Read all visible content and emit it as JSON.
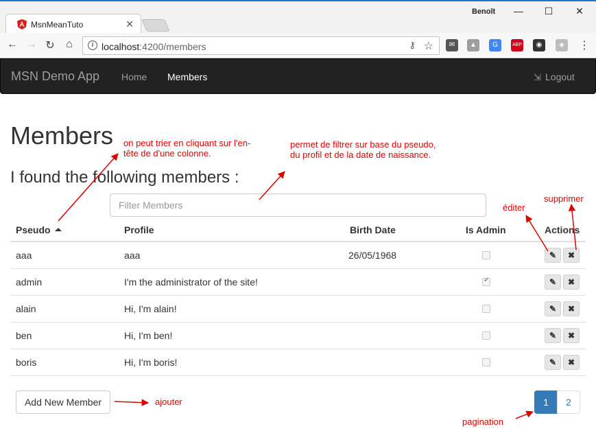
{
  "browser": {
    "tab_title": "MsnMeanTuto",
    "tab_close": "✕",
    "profile_name": "Benoît",
    "url_host": "localhost",
    "url_path": ":4200/members",
    "icons": [
      "back-icon",
      "forward-icon",
      "reload-icon",
      "home-icon",
      "info-icon",
      "key-icon",
      "star-icon"
    ],
    "window_buttons": {
      "minimize": "—",
      "maximize": "☐",
      "close": "✕"
    },
    "extensions": [
      {
        "name": "mail-extension-icon",
        "glyph": "✉",
        "color": "#555555"
      },
      {
        "name": "drive-extension-icon",
        "glyph": "▲",
        "color": "#9e9e9e"
      },
      {
        "name": "translate-extension-icon",
        "glyph": "G",
        "color": "#4285f4"
      },
      {
        "name": "adblock-extension-icon",
        "glyph": "ABP",
        "color": "#d0021b"
      },
      {
        "name": "lastpass-extension-icon",
        "glyph": "◉",
        "color": "#333333"
      },
      {
        "name": "cube-extension-icon",
        "glyph": "◈",
        "color": "#bdbdbd"
      }
    ],
    "menu_glyph": "⋮"
  },
  "navbar": {
    "brand": "MSN Demo App",
    "links": [
      {
        "label": "Home",
        "active": false
      },
      {
        "label": "Members",
        "active": true
      }
    ],
    "logout_icon": "⇲",
    "logout_label": "Logout"
  },
  "main": {
    "title": "Members",
    "subtitle": "I found the following members :",
    "filter_placeholder": "Filter Members",
    "columns": [
      "Pseudo",
      "Profile",
      "Birth Date",
      "Is Admin",
      "Actions"
    ],
    "rows": [
      {
        "pseudo": "aaa",
        "profile": "aaa",
        "birth_date": "26/05/1968",
        "is_admin": false
      },
      {
        "pseudo": "admin",
        "profile": "I'm the administrator of the site!",
        "birth_date": "",
        "is_admin": true
      },
      {
        "pseudo": "alain",
        "profile": "Hi, I'm alain!",
        "birth_date": "",
        "is_admin": false
      },
      {
        "pseudo": "ben",
        "profile": "Hi, I'm ben!",
        "birth_date": "",
        "is_admin": false
      },
      {
        "pseudo": "boris",
        "profile": "Hi, I'm boris!",
        "birth_date": "",
        "is_admin": false
      }
    ],
    "edit_glyph": "✎",
    "delete_glyph": "✖",
    "add_button": "Add New Member",
    "pages": [
      "1",
      "2"
    ],
    "current_page": "1"
  },
  "annotations": {
    "sort": "on peut trier en cliquant sur l'en-tête de d'une colonne.",
    "filter": "permet de filtrer sur base du pseudo, du  profil et de la date de naissance.",
    "edit": "éditer",
    "delete": "supprimer",
    "add": "ajouter",
    "pagination": "pagination",
    "color": "#e00000"
  },
  "colors": {
    "navbar": "#222222",
    "primary": "#337ab7",
    "annotation": "#e00000"
  }
}
